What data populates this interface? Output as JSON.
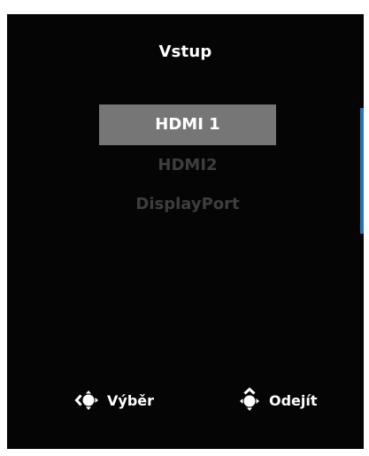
{
  "menu": {
    "title": "Vstup",
    "options": [
      {
        "label": "HDMI 1",
        "selected": true
      },
      {
        "label": "HDMI2",
        "selected": false
      },
      {
        "label": "DisplayPort",
        "selected": false
      }
    ]
  },
  "footer": {
    "select_hint": {
      "icon": "joystick-left-press-icon",
      "label": "Výběr"
    },
    "exit_hint": {
      "icon": "joystick-up-press-icon",
      "label": "Odejít"
    }
  },
  "colors": {
    "background": "#050505",
    "selected_bg": "#767676",
    "inactive_text": "#3e3e3e",
    "accent": "#2a73b5"
  }
}
